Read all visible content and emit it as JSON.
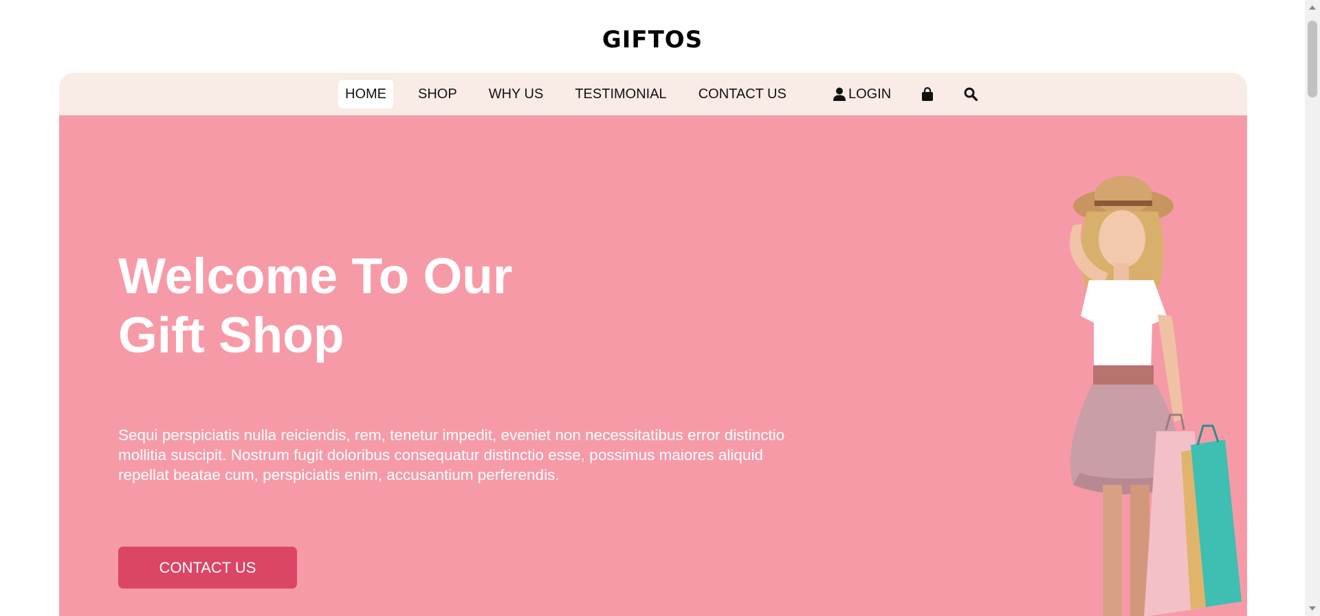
{
  "brand": {
    "name": "GIFTOS"
  },
  "nav": {
    "links": [
      {
        "label": "HOME",
        "active": true
      },
      {
        "label": "SHOP"
      },
      {
        "label": "WHY US"
      },
      {
        "label": "TESTIMONIAL"
      },
      {
        "label": "CONTACT US"
      }
    ],
    "login_label": "LOGIN",
    "icons": [
      "user-icon",
      "shopping-bag-icon",
      "search-icon"
    ]
  },
  "hero": {
    "title_line1": "Welcome To Our",
    "title_line2": "Gift Shop",
    "text": "Sequi perspiciatis nulla reiciendis, rem, tenetur impedit, eveniet non necessitatibus error distinctio mollitia suscipit. Nostrum fugit doloribus consequatur distinctio esse, possimus maiores aliquid repellat beatae cum, perspiciatis enim, accusantium perferendis.",
    "button_label": "CONTACT US"
  },
  "colors": {
    "hero_background": "#f79aa8",
    "nav_background": "#f9ebe6",
    "button": "#db4566",
    "text_light": "#ffffff"
  }
}
